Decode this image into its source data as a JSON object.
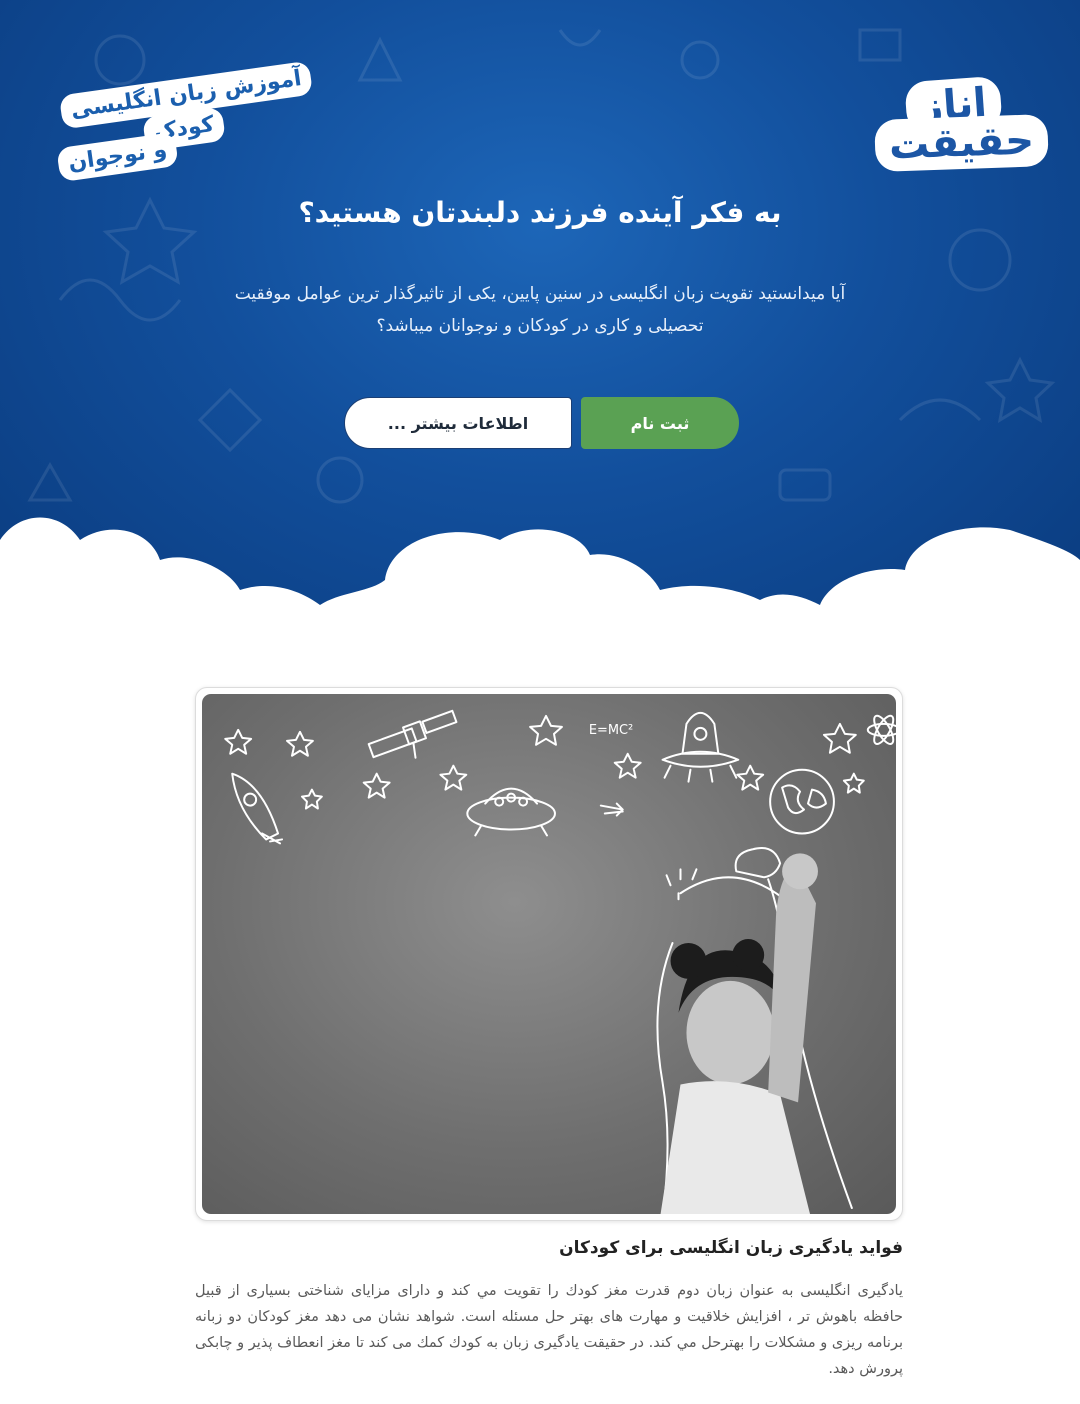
{
  "header": {
    "brand_line1": "اناز",
    "brand_line2": "حقیقت",
    "tagline_line1": "آموزش زبان انگلیسی",
    "tagline_line2": "کودک",
    "tagline_line3": "و نوجوان"
  },
  "hero": {
    "title": "به فکر آینده فرزند دلبندتان هستید؟",
    "description": "آیا میدانستید تقویت زبان انگلیسی در سنین پایین، یکی از تاثیرگذار ترین عوامل موفقیت تحصیلی و کاری در کودکان و نوجوانان میباشد؟",
    "register_label": "ثبت نام",
    "more_label": "اطلاعات بیشتر ..."
  },
  "article": {
    "title": "فواید یادگیری زبان انگلیسی برای کودکان",
    "body": "یادگیری انگلیسی به عنوان زبان دوم قدرت مغز کودك را تقویت مي کند و دارای مزایای شناختی بسیاری از قبیل حافظه باهوش تر ، افزایش خلاقیت و مهارت های بهتر حل مسئله است. شواهد نشان می دهد مغز کودکان دو زبانه برنامه ریزی و مشکلات را بهترحل مي کند. در حقیقت یادگیری زبان به کودك کمك می کند تا مغز انعطاف پذیر و چابکی پرورش دهد.",
    "photo_formula": "E=MC²"
  },
  "colors": {
    "hero_blue": "#124f9c",
    "register_green": "#5aa153",
    "brand_blue": "#1c56a5"
  }
}
